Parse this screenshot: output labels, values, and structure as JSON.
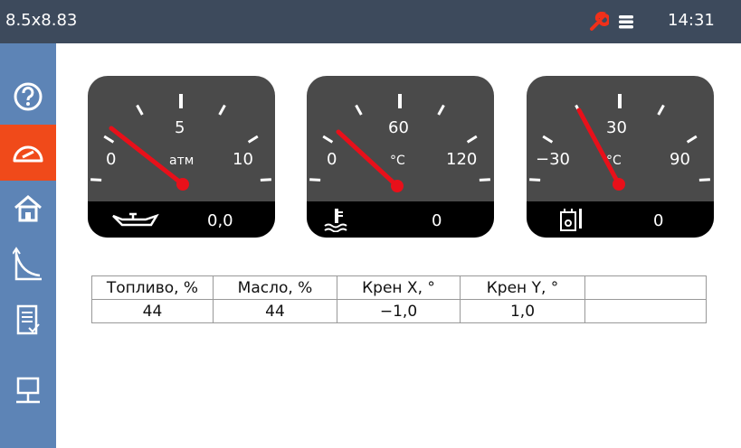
{
  "header": {
    "title": "8.5x8.83",
    "time": "14:31",
    "accent": "#f04a1a"
  },
  "sidebar": {
    "items": [
      {
        "icon": "help-icon"
      },
      {
        "icon": "gauge-icon",
        "active": true
      },
      {
        "icon": "home-icon"
      },
      {
        "icon": "curve-icon"
      },
      {
        "icon": "document-icon"
      },
      {
        "icon": "network-icon"
      }
    ]
  },
  "gauges": [
    {
      "min": "0",
      "mid": "5",
      "max": "10",
      "unit": "атм",
      "value": "0,0",
      "icon": "oil-pressure-icon",
      "needle_fraction": 0.0
    },
    {
      "min": "0",
      "mid": "60",
      "max": "120",
      "unit": "°C",
      "value": "0",
      "icon": "coolant-temperature-icon",
      "needle_fraction": 0.0
    },
    {
      "min": "−30",
      "mid": "30",
      "max": "90",
      "unit": "°C",
      "value": "0",
      "icon": "oil-temperature-icon",
      "needle_fraction": 0.25
    }
  ],
  "table": {
    "headers": [
      "Топливо, %",
      "Масло, %",
      "Крен X, °",
      "Крен Y, °",
      ""
    ],
    "values": [
      "44",
      "44",
      "−1,0",
      "1,0",
      ""
    ]
  }
}
